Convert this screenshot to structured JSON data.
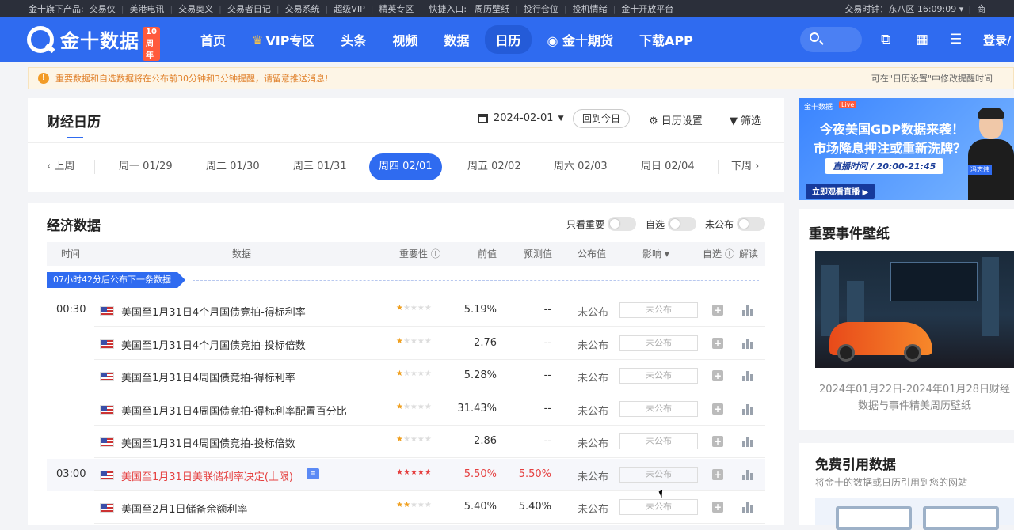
{
  "topbar": {
    "products_label": "金十旗下产品:",
    "products": [
      "交易侠",
      "美港电讯",
      "交易奥义",
      "交易者日记",
      "交易系统",
      "超级VIP",
      "精英专区"
    ],
    "quick_label": "快捷入口:",
    "quick": [
      "周历壁纸",
      "投行仓位",
      "投机情绪",
      "金十开放平台"
    ],
    "timezone": "交易时钟：东八区 16:09:09 ▾",
    "more": "商"
  },
  "nav": {
    "logo_text": "金十数据",
    "logo_badge": "10周年",
    "items": [
      "首页",
      "VIP专区",
      "头条",
      "视频",
      "数据",
      "日历",
      "金十期货",
      "下载APP"
    ],
    "active_index": 5,
    "login": "登录/"
  },
  "notice": {
    "icon": "!",
    "message": "重要数据和自选数据将在公布前30分钟和3分钟提醒，请留意推送消息!",
    "right": "可在\"日历设置\"中修改提醒时间"
  },
  "calendar": {
    "title": "财经日历",
    "date": "2024-02-01",
    "today_button": "回到今日",
    "settings": "日历设置",
    "filter": "筛选",
    "prev_week": "上周",
    "next_week": "下周",
    "days": [
      "周一 01/29",
      "周二 01/30",
      "周三 01/31",
      "周四 02/01",
      "周五 02/02",
      "周六 02/03",
      "周日 02/04"
    ],
    "active_day_index": 3
  },
  "econ": {
    "title": "经济数据",
    "toggles": [
      "只看重要",
      "自选",
      "未公布"
    ],
    "headers": [
      "时间",
      "数据",
      "重要性 ⓘ",
      "前值",
      "预测值",
      "公布值",
      "影响 ▾",
      "自选 ⓘ",
      "解读"
    ],
    "next_release": "07小时42分后公布下一条数据",
    "rows": [
      {
        "time": "00:30",
        "name": "美国至1月31日4个月国债竞拍-得标利率",
        "stars": 1,
        "prev": "5.19%",
        "forecast": "--",
        "published": "未公布",
        "impact": "未公布",
        "highlight": false
      },
      {
        "time": "",
        "name": "美国至1月31日4个月国债竞拍-投标倍数",
        "stars": 1,
        "prev": "2.76",
        "forecast": "--",
        "published": "未公布",
        "impact": "未公布",
        "highlight": false
      },
      {
        "time": "",
        "name": "美国至1月31日4周国债竞拍-得标利率",
        "stars": 1,
        "prev": "5.28%",
        "forecast": "--",
        "published": "未公布",
        "impact": "未公布",
        "highlight": false
      },
      {
        "time": "",
        "name": "美国至1月31日4周国债竞拍-得标利率配置百分比",
        "stars": 1,
        "prev": "31.43%",
        "forecast": "--",
        "published": "未公布",
        "impact": "未公布",
        "highlight": false
      },
      {
        "time": "",
        "name": "美国至1月31日4周国债竞拍-投标倍数",
        "stars": 1,
        "prev": "2.86",
        "forecast": "--",
        "published": "未公布",
        "impact": "未公布",
        "highlight": false
      },
      {
        "time": "03:00",
        "name": "美国至1月31日美联储利率决定(上限)",
        "stars": 5,
        "prev": "5.50%",
        "forecast": "5.50%",
        "published": "未公布",
        "impact": "未公布",
        "highlight": true
      },
      {
        "time": "",
        "name": "美国至2月1日储备余额利率",
        "stars": 2,
        "prev": "5.40%",
        "forecast": "5.40%",
        "published": "未公布",
        "impact": "未公布",
        "highlight": false
      }
    ]
  },
  "ad": {
    "brand": "金十数据",
    "live": "Live",
    "line1": "今夜美国GDP数据来袭！",
    "line2": "市场降息押注或重新洗牌？",
    "time": "直播时间 / 20:00-21:45",
    "cta": "立即观看直播 ▶",
    "host_tag": "冯志炜"
  },
  "wallpaper": {
    "title": "重要事件壁纸",
    "caption": "2024年01月22日-2024年01月28日财经数据与事件精美周历壁纸"
  },
  "free_data": {
    "title": "免费引用数据",
    "subtitle": "将金十的数据或日历引用到您的网站"
  }
}
